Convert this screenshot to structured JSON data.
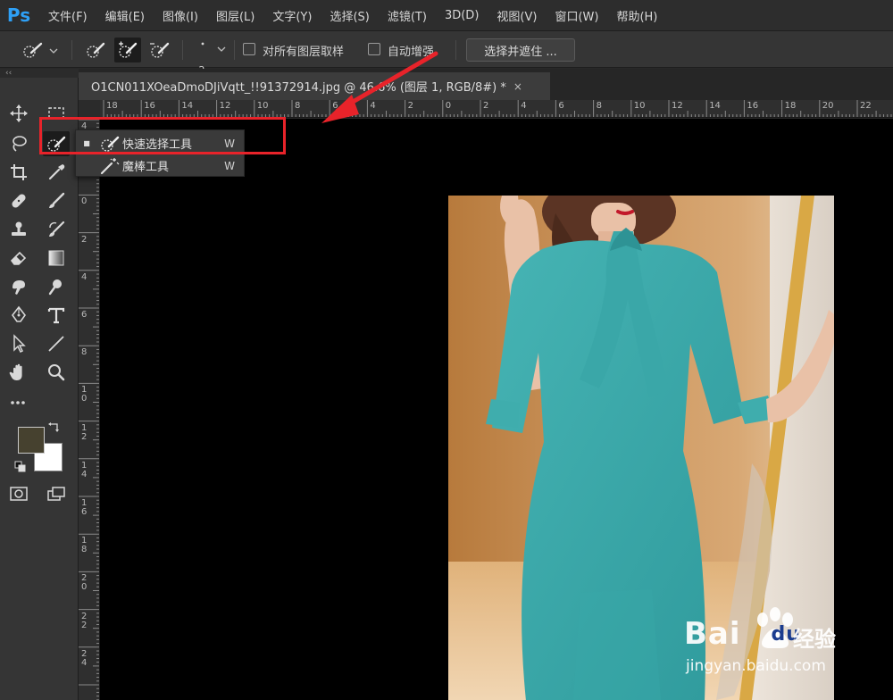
{
  "app": {
    "logo": "Ps",
    "menus": [
      "文件(F)",
      "编辑(E)",
      "图像(I)",
      "图层(L)",
      "文字(Y)",
      "选择(S)",
      "滤镜(T)",
      "3D(D)",
      "视图(V)",
      "窗口(W)",
      "帮助(H)"
    ]
  },
  "options": {
    "brush_size": "2",
    "sample_all_layers_label": "对所有图层取样",
    "auto_enhance_label": "自动增强",
    "select_and_mask_label": "选择并遮住 ..."
  },
  "document": {
    "tab_title": "O1CN011XOeaDmoDJiVqtt_!!91372914.jpg @ 46.6% (图层 1, RGB/8#) *",
    "close_glyph": "×"
  },
  "rulers": {
    "top_labels": [
      "18",
      "16",
      "14",
      "12",
      "10",
      "8",
      "6",
      "4",
      "2",
      "0",
      "2",
      "4",
      "6",
      "8",
      "10",
      "12",
      "14",
      "16",
      "18",
      "20",
      "22"
    ],
    "left_labels": [
      "4",
      "2",
      "0",
      "2",
      "4",
      "6",
      "8",
      "1 0",
      "1 2",
      "1 4",
      "1 6",
      "1 8",
      "2 0",
      "2 2",
      "2 4"
    ]
  },
  "flyout": {
    "items": [
      {
        "label": "快速选择工具",
        "shortcut": "W",
        "selected": true,
        "icon": "quick-selection-icon"
      },
      {
        "label": "魔棒工具",
        "shortcut": "W",
        "selected": false,
        "icon": "magic-wand-icon"
      }
    ]
  },
  "swatches": {
    "foreground": "#46412f",
    "background": "#ffffff"
  },
  "colors": {
    "annotation_red": "#e8232a",
    "ps_blue": "#2ea0f6",
    "dress_teal": "#3fa9aa"
  },
  "watermark": {
    "brand": "Bai",
    "brand2": "du",
    "cn": "经验",
    "url": "jingyan.baidu.com"
  }
}
